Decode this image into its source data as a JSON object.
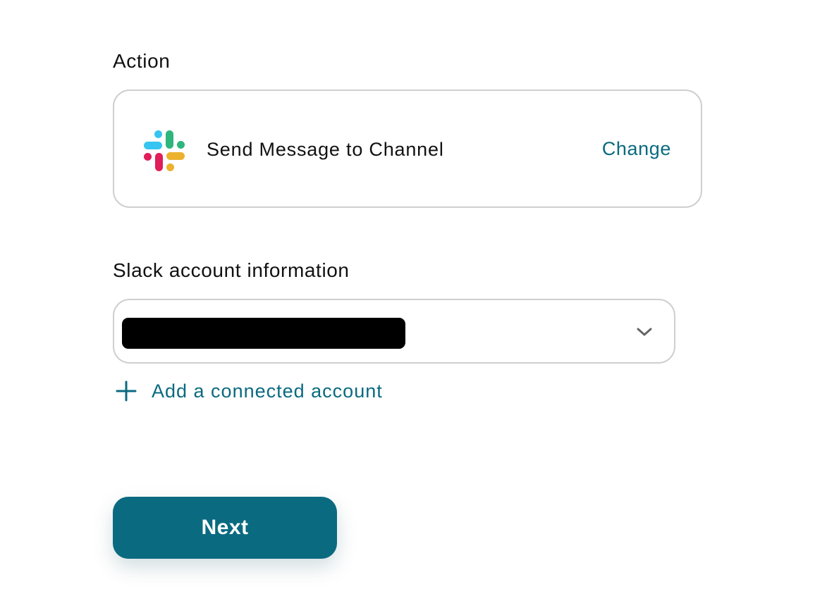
{
  "action_section": {
    "label": "Action",
    "app_icon": "slack-icon",
    "action_name": "Send Message to Channel",
    "change_label": "Change"
  },
  "account_section": {
    "label": "Slack account information",
    "selected_account": "",
    "add_account_label": "Add a connected account"
  },
  "footer": {
    "next_label": "Next"
  },
  "colors": {
    "accent": "#0a6a80",
    "border": "#cfcfcf",
    "redaction": "#000000",
    "slack_blue": "#36c5f0",
    "slack_green": "#2eb67d",
    "slack_yellow": "#ecb22e",
    "slack_red": "#e01e5a"
  }
}
